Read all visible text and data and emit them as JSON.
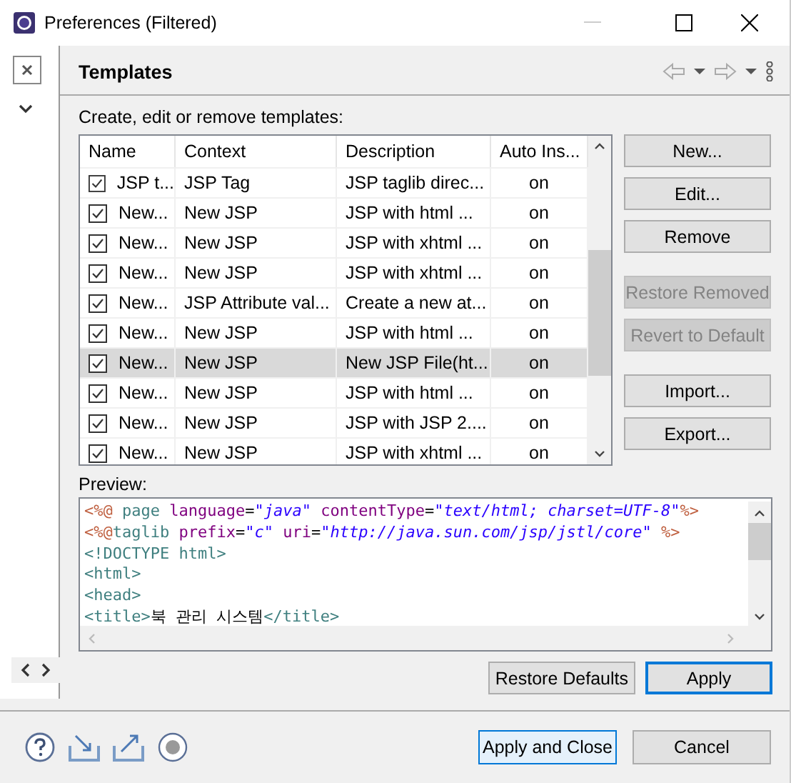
{
  "window": {
    "title": "Preferences (Filtered)"
  },
  "page": {
    "title": "Templates",
    "intro": "Create, edit or remove templates:"
  },
  "table": {
    "columns": [
      "Name",
      "Context",
      "Description",
      "Auto Ins..."
    ],
    "rows": [
      {
        "name": "JSP t...",
        "context": "JSP Tag",
        "description": "JSP taglib direc...",
        "auto": "on",
        "checked": true,
        "selected": false
      },
      {
        "name": "New...",
        "context": "New JSP",
        "description": "JSP with html ...",
        "auto": "on",
        "checked": true,
        "selected": false
      },
      {
        "name": "New...",
        "context": "New JSP",
        "description": "JSP with xhtml ...",
        "auto": "on",
        "checked": true,
        "selected": false
      },
      {
        "name": "New...",
        "context": "New JSP",
        "description": "JSP with xhtml ...",
        "auto": "on",
        "checked": true,
        "selected": false
      },
      {
        "name": "New...",
        "context": "JSP Attribute val...",
        "description": "Create a new at...",
        "auto": "on",
        "checked": true,
        "selected": false
      },
      {
        "name": "New...",
        "context": "New JSP",
        "description": "JSP with html ...",
        "auto": "on",
        "checked": true,
        "selected": false
      },
      {
        "name": "New...",
        "context": "New JSP",
        "description": "New JSP File(ht...",
        "auto": "on",
        "checked": true,
        "selected": true
      },
      {
        "name": "New...",
        "context": "New JSP",
        "description": "JSP with html ...",
        "auto": "on",
        "checked": true,
        "selected": false
      },
      {
        "name": "New...",
        "context": "New JSP",
        "description": "JSP with JSP 2....",
        "auto": "on",
        "checked": true,
        "selected": false
      },
      {
        "name": "New...",
        "context": "New JSP",
        "description": "JSP with xhtml ...",
        "auto": "on",
        "checked": true,
        "selected": false
      }
    ]
  },
  "side_button_groups": [
    [
      {
        "label": "New...",
        "disabled": false
      },
      {
        "label": "Edit...",
        "disabled": false
      },
      {
        "label": "Remove",
        "disabled": false
      }
    ],
    [
      {
        "label": "Restore Removed",
        "disabled": true
      },
      {
        "label": "Revert to Default",
        "disabled": true
      }
    ],
    [
      {
        "label": "Import...",
        "disabled": false
      },
      {
        "label": "Export...",
        "disabled": false
      }
    ]
  ],
  "preview": {
    "label": "Preview:",
    "lines": [
      [
        {
          "kind": "delim",
          "text": "<%@"
        },
        {
          "kind": "tag",
          "text": " page"
        },
        {
          "kind": "attr",
          "text": " language"
        },
        {
          "kind": "text",
          "text": "="
        },
        {
          "kind": "value",
          "text": "\"java\""
        },
        {
          "kind": "attr",
          "text": " contentType"
        },
        {
          "kind": "text",
          "text": "="
        },
        {
          "kind": "value",
          "text": "\"text/html; charset=UTF-8\""
        },
        {
          "kind": "delim",
          "text": "%>"
        }
      ],
      [
        {
          "kind": "delim",
          "text": "<%@"
        },
        {
          "kind": "tag",
          "text": "taglib"
        },
        {
          "kind": "attr",
          "text": " prefix"
        },
        {
          "kind": "text",
          "text": "="
        },
        {
          "kind": "value",
          "text": "\"c\""
        },
        {
          "kind": "attr",
          "text": " uri"
        },
        {
          "kind": "text",
          "text": "="
        },
        {
          "kind": "value",
          "text": "\"http://java.sun.com/jsp/jstl/core\""
        },
        {
          "kind": "delim",
          "text": " %>"
        }
      ],
      [
        {
          "kind": "tag",
          "text": "<!DOCTYPE html>"
        }
      ],
      [
        {
          "kind": "tag",
          "text": "<html>"
        }
      ],
      [
        {
          "kind": "tag",
          "text": "<head>"
        }
      ],
      [
        {
          "kind": "tag",
          "text": "<title>"
        },
        {
          "kind": "text",
          "text": "북 관리 시스템"
        },
        {
          "kind": "tag",
          "text": "</title>"
        }
      ]
    ]
  },
  "page_buttons": [
    {
      "label": "Restore Defaults",
      "default": false
    },
    {
      "label": "Apply",
      "default": true
    }
  ],
  "dialog_buttons": [
    {
      "label": "Apply and Close",
      "default": true
    },
    {
      "label": "Cancel",
      "default": false
    }
  ]
}
